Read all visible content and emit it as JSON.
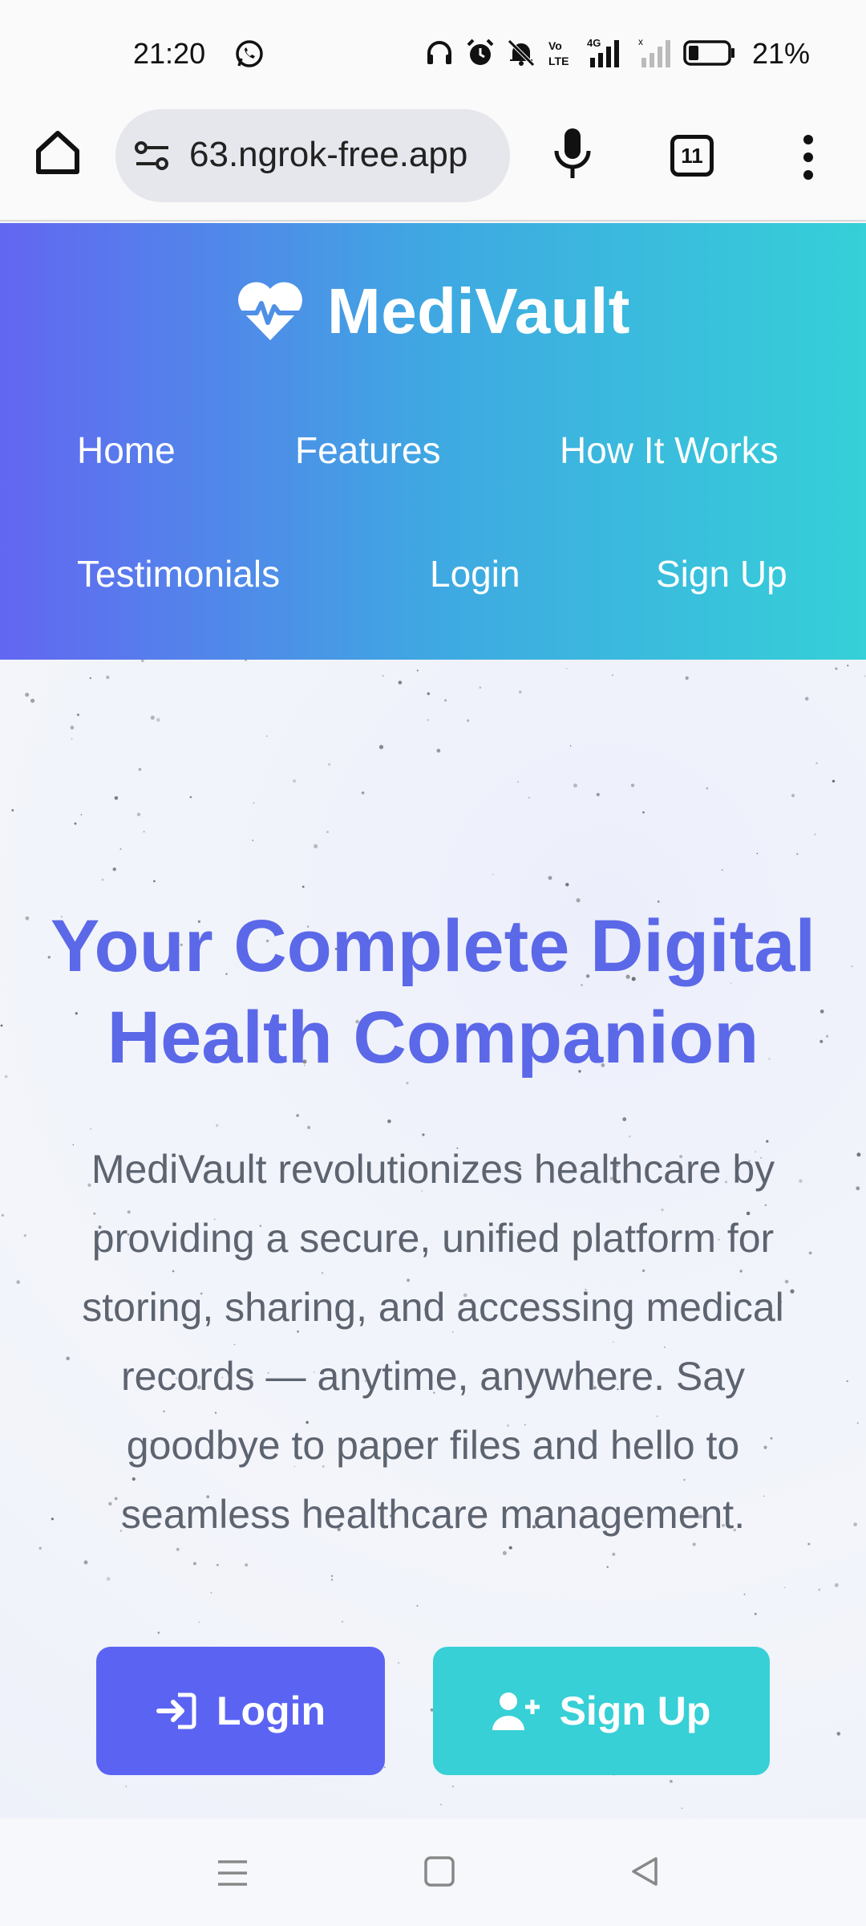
{
  "status_bar": {
    "time": "21:20",
    "network": "4G",
    "battery": "21%",
    "icons": [
      "whatsapp-icon",
      "headphones-icon",
      "alarm-icon",
      "mute-icon",
      "volte-icon",
      "signal-icon",
      "battery-icon"
    ]
  },
  "browser": {
    "url": "63.ngrok-free.app",
    "tab_count": "11",
    "icons": [
      "home-icon",
      "site-settings-icon",
      "mic-icon",
      "tabs-icon",
      "more-menu-icon"
    ]
  },
  "site": {
    "brand": "MediVault",
    "brand_icon": "heart-pulse-icon",
    "nav": {
      "home": "Home",
      "features": "Features",
      "how_it_works": "How It Works",
      "testimonials": "Testimonials",
      "login": "Login",
      "signup": "Sign Up"
    }
  },
  "hero": {
    "title": "Your Complete Digital Health Companion",
    "description": "MediVault revolutionizes healthcare by providing a secure, unified platform for storing, sharing, and accessing medical records — anytime, anywhere. Say goodbye to paper files and hello to seamless healthcare management.",
    "login_button": "Login",
    "signup_button": "Sign Up"
  },
  "colors": {
    "primary": "#5b64f2",
    "accent": "#36d0d6",
    "title": "#5b68e8",
    "header_gradient_start": "#6366f1",
    "header_gradient_end": "#35d0d8"
  }
}
